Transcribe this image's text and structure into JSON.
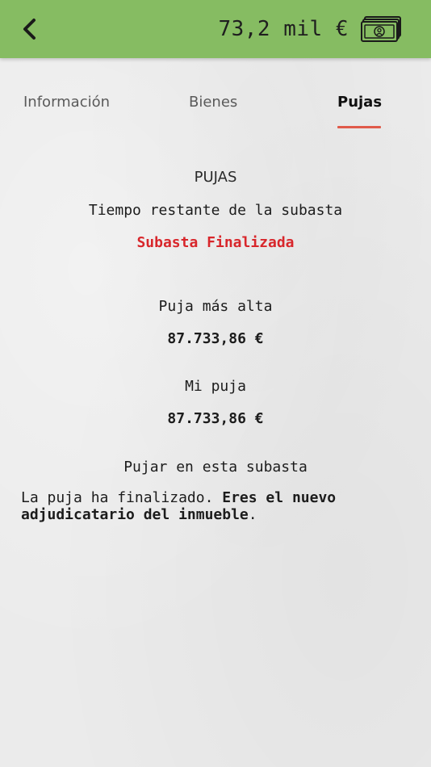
{
  "header": {
    "back_icon": "chevron-left-icon",
    "balance": "73,2 mil €",
    "wallet_icon": "banknotes-icon",
    "bar_color": "#86bc62"
  },
  "tabs": [
    {
      "label": "Información",
      "active": false
    },
    {
      "label": "Bienes",
      "active": false
    },
    {
      "label": "Pujas",
      "active": true
    }
  ],
  "active_tab_underline_color": "#e05a4a",
  "pujas": {
    "title": "PUJAS",
    "remaining_label": "Tiempo restante de la subasta",
    "status": "Subasta Finalizada",
    "status_color": "#d8262b",
    "highest_label": "Puja más alta",
    "highest_value": "87.733,86 €",
    "my_bid_label": "Mi puja",
    "my_bid_value": "87.733,86 €",
    "bid_label": "Pujar en esta subasta",
    "result_text_normal": "La puja ha finalizado. ",
    "result_text_bold": "Eres el nuevo adjudicatario del inmueble",
    "result_text_end": "."
  }
}
